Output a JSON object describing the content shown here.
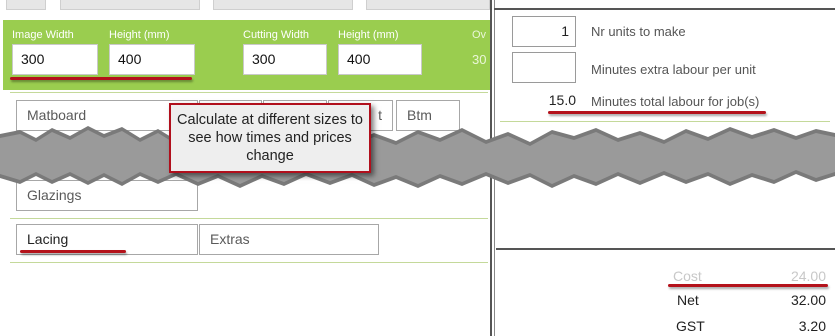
{
  "image_size": {
    "width_label": "Image Width",
    "height_label": "Height (mm)",
    "width_value": "300",
    "height_value": "400"
  },
  "cutting_size": {
    "width_label": "Cutting Width",
    "height_label": "Height (mm)",
    "width_value": "300",
    "height_value": "400"
  },
  "overflow": {
    "label": "Ov",
    "value": "30"
  },
  "sections": {
    "matboard": "Matboard",
    "partial": "t",
    "btm": "Btm",
    "glazings": "Glazings",
    "lacing": "Lacing",
    "extras": "Extras"
  },
  "callout": {
    "text": "Calculate at different sizes to see how times and prices change"
  },
  "labour": {
    "units_value": "1",
    "units_label": "Nr units to make",
    "extra_value": "",
    "extra_label": "Minutes extra labour per unit",
    "total_value": "15.0",
    "total_label": "Minutes total labour for job(s)"
  },
  "summary": {
    "cost_label": "Cost",
    "cost_value": "24.00",
    "net_label": "Net",
    "net_value": "32.00",
    "gst_label": "GST",
    "gst_value": "3.20"
  },
  "colors": {
    "accent_green": "#9acd4f",
    "annotation_red": "#b4121b"
  }
}
